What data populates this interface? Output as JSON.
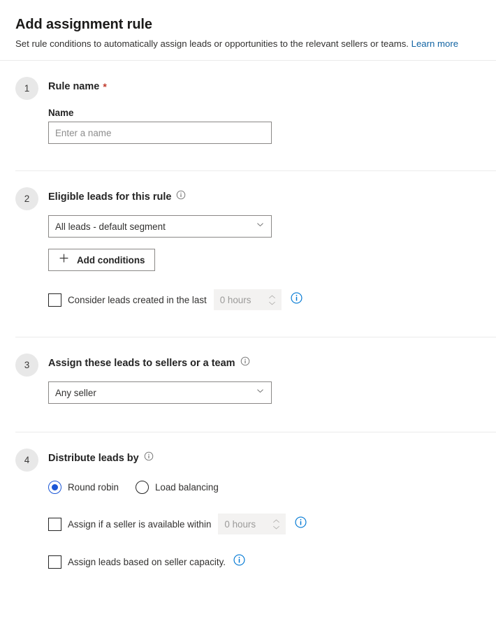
{
  "header": {
    "title": "Add assignment rule",
    "description": "Set rule conditions to automatically assign leads or opportunities to the relevant sellers or teams.",
    "learn_more": "Learn more"
  },
  "colors": {
    "accent_blue": "#0078d4",
    "link_blue": "#1264a3",
    "radio_blue": "#1a56d6",
    "required_red": "#c0392b",
    "badge_bg": "#e8e8e8",
    "divider": "#ebebeb",
    "border": "#8a8886"
  },
  "sections": [
    {
      "step": "1",
      "title": "Rule name",
      "required_mark": "*",
      "field_label": "Name",
      "name_input": {
        "value": "",
        "placeholder": "Enter a name"
      }
    },
    {
      "step": "2",
      "title": "Eligible leads for this rule",
      "info_icon": "info-icon",
      "segment_dropdown": {
        "selected": "All leads - default segment",
        "chevron": "chevron-down-icon"
      },
      "add_conditions_button": {
        "label": "Add conditions",
        "icon": "plus-icon"
      },
      "created_in_last": {
        "label": "Consider leads created in the last",
        "checked": false,
        "spinner_value": "0 hours",
        "info_icon": "info-icon"
      }
    },
    {
      "step": "3",
      "title": "Assign these leads to sellers or a team",
      "info_icon": "info-icon",
      "assignee_dropdown": {
        "selected": "Any seller",
        "chevron": "chevron-down-icon"
      }
    },
    {
      "step": "4",
      "title": "Distribute leads by",
      "info_icon": "info-icon",
      "distribution_options": [
        {
          "label": "Round robin",
          "selected": true
        },
        {
          "label": "Load balancing",
          "selected": false
        }
      ],
      "available_within": {
        "label": "Assign if a seller is available within",
        "checked": false,
        "spinner_value": "0 hours",
        "info_icon": "info-icon"
      },
      "seller_capacity": {
        "label": "Assign leads based on seller capacity.",
        "checked": false,
        "info_icon": "info-icon"
      }
    }
  ]
}
